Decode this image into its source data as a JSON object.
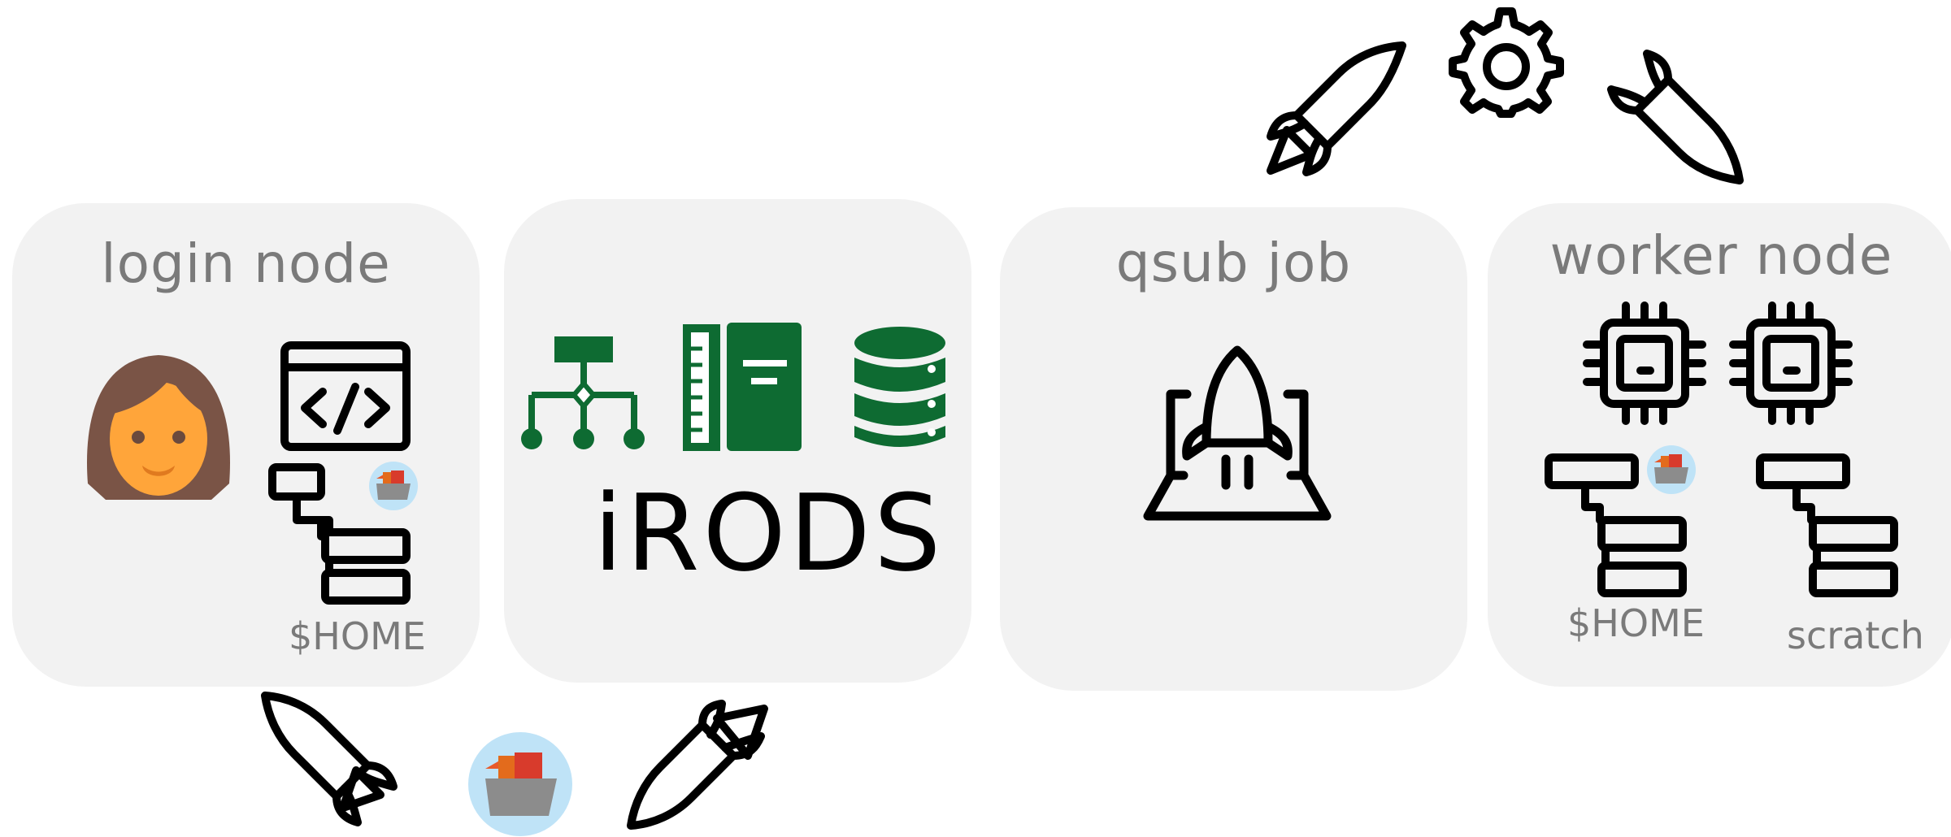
{
  "panels": {
    "login": {
      "title": "login node",
      "home_label": "$HOME"
    },
    "irods": {
      "title": "iRODS"
    },
    "qsub": {
      "title": "qsub job"
    },
    "worker": {
      "title": "worker node",
      "home_label": "$HOME",
      "scratch_label": "scratch"
    }
  },
  "colors": {
    "panel_bg": "#f2f2f2",
    "label_gray": "#7a7a7a",
    "irods_green": "#0e6b32",
    "avatar_hair": "#7a5446",
    "avatar_skin": "#ffa53a",
    "folder_badge_bg": "#bfe3f7"
  },
  "icons": [
    "rocket-icon",
    "gear-icon",
    "user-avatar-icon",
    "code-window-icon",
    "file-tree-icon",
    "folder-badge-icon",
    "hierarchy-icon",
    "book-icon",
    "database-icon",
    "rocket-launch-icon",
    "cpu-chip-icon"
  ]
}
